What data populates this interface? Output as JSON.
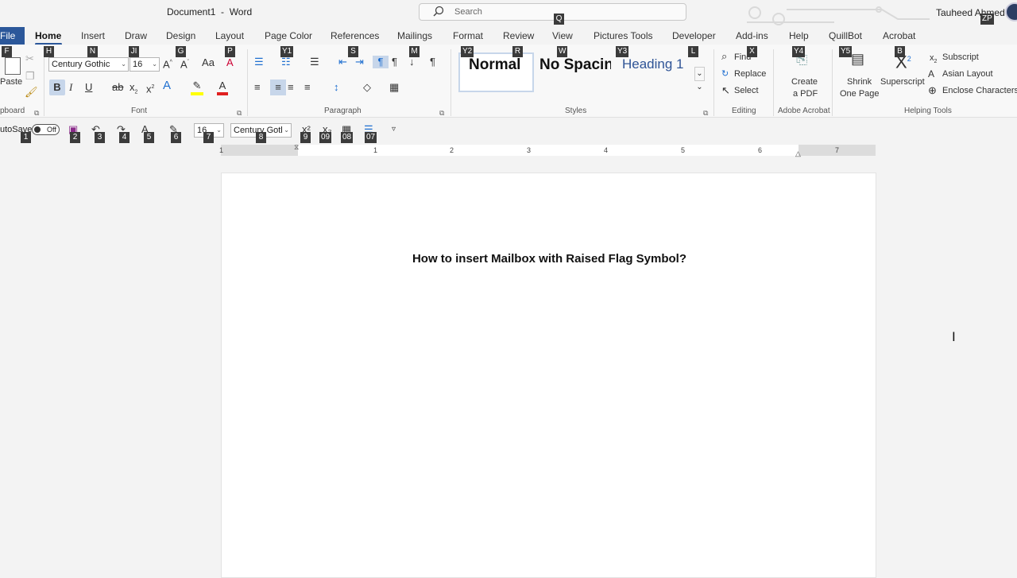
{
  "titlebar": {
    "doc_title": "Document1  -  Word",
    "search_placeholder": "Search",
    "user_name": "Tauheed Ahmed"
  },
  "tabs": [
    "File",
    "Home",
    "Insert",
    "Draw",
    "Design",
    "Layout",
    "Page Color",
    "References",
    "Mailings",
    "Format",
    "Review",
    "View",
    "Pictures Tools",
    "Developer",
    "Add-ins",
    "Help",
    "QuillBot",
    "Acrobat"
  ],
  "keytips": {
    "file": "F",
    "home": "H",
    "insert": "N",
    "draw": "JI",
    "design": "G",
    "layout": "P",
    "page_color": "Y1",
    "references": "S",
    "mailings": "M",
    "format": "Y2",
    "review": "R",
    "view": "W",
    "pictures_tools": "Y3",
    "developer": "L",
    "addins": "X",
    "help": "Y4",
    "quillbot": "Y5",
    "acrobat": "B",
    "user": "ZP",
    "search": "Q",
    "qat": [
      "1",
      "2",
      "3",
      "4",
      "5",
      "6",
      "7",
      "8",
      "9",
      "09",
      "08",
      "07"
    ]
  },
  "ribbon": {
    "clipboard": {
      "paste": "Paste",
      "label": "pboard"
    },
    "font": {
      "name": "Century Gothic",
      "size": "16",
      "label": "Font"
    },
    "paragraph": {
      "label": "Paragraph"
    },
    "styles": {
      "items": [
        "Normal",
        "No Spacin",
        "Heading 1"
      ],
      "label": "Styles"
    },
    "editing": {
      "find": "Find",
      "replace": "Replace",
      "select": "Select",
      "label": "Editing"
    },
    "acrobat": {
      "create_line1": "Create",
      "create_line2": "a PDF",
      "label": "Adobe Acrobat"
    },
    "helping": {
      "shrink_line1": "Shrink",
      "shrink_line2": "One Page",
      "superscript": "Superscript",
      "subscript": "Subscript",
      "asian_layout": "Asian Layout",
      "enclose": "Enclose Characters",
      "label": "Helping Tools"
    }
  },
  "qat": {
    "autosave": "utoSave",
    "toggle": "Off",
    "font_size": "16",
    "font_name": "Century Gotl"
  },
  "ruler": {
    "numbers": [
      "1",
      "1",
      "2",
      "3",
      "4",
      "5",
      "6",
      "7"
    ]
  },
  "document": {
    "heading": "How to insert Mailbox with Raised Flag Symbol?"
  },
  "colors": {
    "accent": "#2b579a",
    "highlight": "#ffff00",
    "font_color": "#e02020"
  }
}
